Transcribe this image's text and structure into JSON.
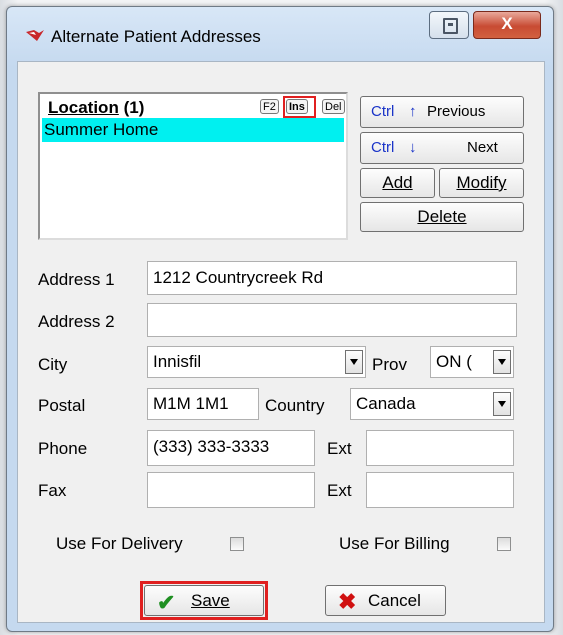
{
  "window": {
    "title": "Alternate Patient Addresses"
  },
  "titlebar": {
    "close_glyph": "X"
  },
  "locations": {
    "header_label": "Location",
    "header_count": "(1)",
    "keys": {
      "f2": "F2",
      "ins": "Ins",
      "del": "Del"
    },
    "items": [
      {
        "label": "Summer Home"
      }
    ]
  },
  "nav": {
    "previous_prefix": "Ctrl",
    "previous_arrow": "↑",
    "previous_label": "Previous",
    "next_prefix": "Ctrl",
    "next_arrow": "↓",
    "next_label": "Next",
    "add_label": "Add",
    "modify_label": "Modify",
    "delete_label": "Delete"
  },
  "form": {
    "address1_label": "Address 1",
    "address1_value": "1212 Countrycreek Rd",
    "address2_label": "Address 2",
    "address2_value": "",
    "city_label": "City",
    "city_value": "Innisfil",
    "prov_label": "Prov",
    "prov_value": "ON (",
    "postal_label": "Postal",
    "postal_value": "M1M 1M1",
    "country_label": "Country",
    "country_value": "Canada",
    "phone_label": "Phone",
    "phone_value": "(333) 333-3333",
    "phone_ext_label": "Ext",
    "phone_ext_value": "",
    "fax_label": "Fax",
    "fax_value": "",
    "fax_ext_label": "Ext",
    "fax_ext_value": ""
  },
  "options": {
    "delivery_label": "Use For Delivery",
    "billing_label": "Use For Billing"
  },
  "actions": {
    "save_label": "Save",
    "cancel_label": "Cancel"
  },
  "colors": {
    "selected_row": "#00f0f0",
    "highlight_frame": "#e02020",
    "hotkey_text": "#1a34c8"
  }
}
